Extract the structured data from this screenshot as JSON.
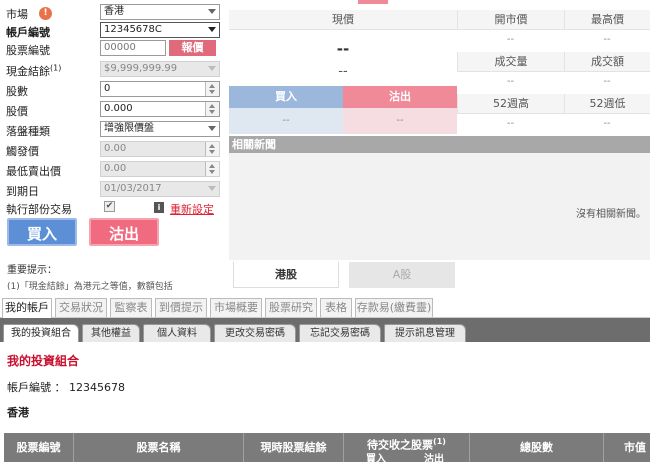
{
  "form": {
    "market_label": "市場",
    "market_value": "香港",
    "account_label": "帳戶編號",
    "account_value": "12345678C",
    "stock_code_label": "股票編號",
    "stock_code_value": "00000",
    "quote_button": "報價",
    "cash_balance_label": "現金結餘",
    "cash_balance_sup": "(1)",
    "cash_balance_value": "$9,999,999.99",
    "quantity_label": "股數",
    "quantity_value": "0",
    "price_label": "股價",
    "price_value": "0.000",
    "order_type_label": "落盤種類",
    "order_type_value": "增強限價盤",
    "trigger_price_label": "觸發價",
    "trigger_price_value": "0.00",
    "min_price_label": "最低賣出價",
    "min_price_value": "0.00",
    "expiry_label": "到期日",
    "expiry_value": "01/03/2017",
    "partial_label": "執行部份交易",
    "partial_check": "✔",
    "reset_link": "重新設定",
    "buy_button": "買入",
    "sell_button": "沽出",
    "notice_title": "重要提示：",
    "notice_text": "(1)「現金結餘」為港元之等值，數額包括"
  },
  "quote": {
    "current_price_label": "現價",
    "current_price_value": "--",
    "current_change_value": "--",
    "open_label": "開市價",
    "open_value": "--",
    "high_label": "最高價",
    "high_value": "--",
    "volume_label": "成交量",
    "volume_value": "--",
    "turnover_label": "成交額",
    "turnover_value": "--",
    "high52_label": "52週高",
    "high52_value": "--",
    "low52_label": "52週低",
    "low52_value": "--",
    "bid_label": "買入",
    "ask_label": "沽出",
    "bid_value": "--",
    "ask_value": "--",
    "news_title": "相關新聞",
    "no_news": "沒有相關新聞。",
    "tab_hk": "港股",
    "tab_a": "A股"
  },
  "main_tabs": [
    "我的帳戶",
    "交易狀況",
    "監察表",
    "到價提示",
    "市場概要",
    "股票研究",
    "表格",
    "存款易(繳費靈)"
  ],
  "sub_tabs": [
    "我的投資組合",
    "其他權益",
    "個人資料",
    "更改交易密碼",
    "忘記交易密碼",
    "提示訊息管理"
  ],
  "content": {
    "section_title": "我的投資組合",
    "account_line": "帳戶編號 ： 12345678",
    "market_title": "香港",
    "table_headers": {
      "stock_code": "股票編號",
      "stock_name": "股票名稱",
      "current_balance": "現時股票結餘",
      "pending": "待交收之股票",
      "pending_sup": "(1)",
      "pending_buy": "買入",
      "pending_sell": "沽出",
      "total_shares": "總股數",
      "market_value": "市值"
    }
  },
  "colors": {
    "buy_blue": "#5c8fd6",
    "sell_red": "#f06b7f",
    "accent_red": "#c8102e",
    "dark_bar": "#6d6d6d"
  }
}
